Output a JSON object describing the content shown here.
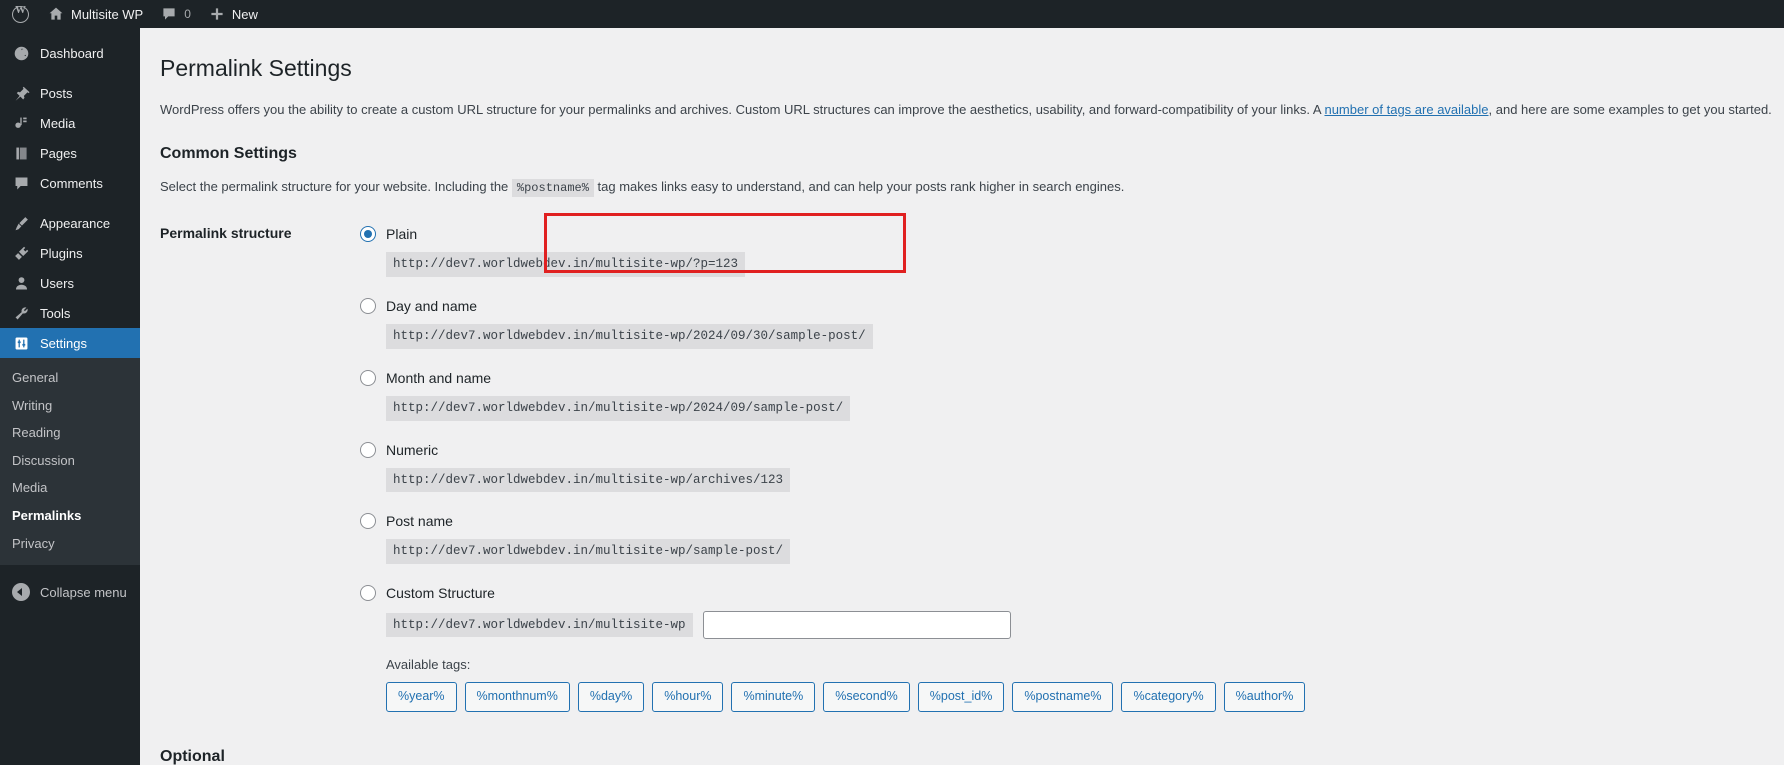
{
  "adminbar": {
    "logo_icon": "wordpress-logo-icon",
    "site_name": "Multisite WP",
    "home_icon": "home-icon",
    "comments_icon": "comment-bubble-icon",
    "comment_count": "0",
    "plus_icon": "plus-icon",
    "new_label": "New"
  },
  "sidebar": {
    "items": [
      {
        "label": "Dashboard",
        "icon": "dashboard-icon",
        "current": false
      },
      {
        "label": "Posts",
        "icon": "pin-icon",
        "current": false
      },
      {
        "label": "Media",
        "icon": "media-icon",
        "current": false
      },
      {
        "label": "Pages",
        "icon": "page-icon",
        "current": false
      },
      {
        "label": "Comments",
        "icon": "comment-bubble-icon",
        "current": false
      },
      {
        "label": "Appearance",
        "icon": "paintbrush-icon",
        "current": false
      },
      {
        "label": "Plugins",
        "icon": "plug-icon",
        "current": false
      },
      {
        "label": "Users",
        "icon": "user-icon",
        "current": false
      },
      {
        "label": "Tools",
        "icon": "wrench-icon",
        "current": false
      },
      {
        "label": "Settings",
        "icon": "settings-sliders-icon",
        "current": true
      }
    ],
    "submenu": [
      {
        "label": "General",
        "current": false
      },
      {
        "label": "Writing",
        "current": false
      },
      {
        "label": "Reading",
        "current": false
      },
      {
        "label": "Discussion",
        "current": false
      },
      {
        "label": "Media",
        "current": false
      },
      {
        "label": "Permalinks",
        "current": true
      },
      {
        "label": "Privacy",
        "current": false
      }
    ],
    "collapse_label": "Collapse menu",
    "collapse_icon": "collapse-arrow-left-icon",
    "active_color": "#2271b1"
  },
  "main": {
    "page_title": "Permalink Settings",
    "intro_before": "WordPress offers you the ability to create a custom URL structure for your permalinks and archives. Custom URL structures can improve the aesthetics, usability, and forward-compatibility of your links. A ",
    "intro_link": "number of tags are available",
    "intro_after": ", and here are some examples to get you started.",
    "common_settings_title": "Common Settings",
    "common_desc_before": "Select the permalink structure for your website. Including the ",
    "common_desc_code": "%postname%",
    "common_desc_after": " tag makes links easy to understand, and can help your posts rank higher in search engines.",
    "field_label": "Permalink structure",
    "options": [
      {
        "label": "Plain",
        "url": "http://dev7.worldwebdev.in/multisite-wp/?p=123",
        "checked": true
      },
      {
        "label": "Day and name",
        "url": "http://dev7.worldwebdev.in/multisite-wp/2024/09/30/sample-post/",
        "checked": false
      },
      {
        "label": "Month and name",
        "url": "http://dev7.worldwebdev.in/multisite-wp/2024/09/sample-post/",
        "checked": false
      },
      {
        "label": "Numeric",
        "url": "http://dev7.worldwebdev.in/multisite-wp/archives/123",
        "checked": false
      },
      {
        "label": "Post name",
        "url": "http://dev7.worldwebdev.in/multisite-wp/sample-post/",
        "checked": false
      }
    ],
    "custom": {
      "label": "Custom Structure",
      "prefix": "http://dev7.worldwebdev.in/multisite-wp",
      "value": "",
      "placeholder": ""
    },
    "available_tags_label": "Available tags:",
    "tags": [
      "%year%",
      "%monthnum%",
      "%day%",
      "%hour%",
      "%minute%",
      "%second%",
      "%post_id%",
      "%postname%",
      "%category%",
      "%author%"
    ],
    "optional_title": "Optional",
    "highlight_color": "#e02020"
  }
}
